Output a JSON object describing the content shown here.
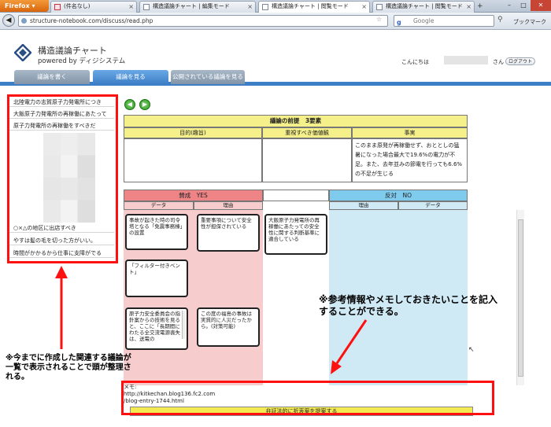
{
  "browser": {
    "app_button": "Firefox ▾",
    "tabs": [
      {
        "label": "(件名なし)"
      },
      {
        "label": "構造議論チャート | 編集モード"
      },
      {
        "label": "構造議論チャート | 閲覧モード"
      },
      {
        "label": "構造議論チャート | 閲覧モード"
      }
    ],
    "url": "structure-notebook.com/discuss/read.php",
    "search_placeholder": "Google",
    "bookmarks_label": "ブックマーク"
  },
  "header": {
    "title": "構造議論チャート",
    "subtitle": "powered by ディジシステム",
    "greeting": "こんにちは",
    "san": "さん",
    "logout": "ログアウト"
  },
  "nav_tabs": [
    {
      "label": "議論を書く"
    },
    {
      "label": "議論を見る"
    },
    {
      "label": "公開されている議論を見る"
    }
  ],
  "sidebar": {
    "items": [
      "北陸電力の志賀原子力発電所につき",
      "大飯原子力発電所の再稼働にあたって",
      "原子力発電所の再稼働をすべきだ",
      "○×△の地区に出店すべき",
      "やすは髪の毛を切った方がいい。",
      "時間がかかるから仕事に支障がでる"
    ]
  },
  "premise": {
    "title": "議論の前提　3要素",
    "columns": [
      "目的(趣旨)",
      "重視すべき価値観",
      "事実"
    ],
    "fact_text": "このまま原発が再稼働せず、おととしの猛暑になった場合最大で19.6%の電力が不足。また、去年並みの節電を行っても6.6%の不足が生じる"
  },
  "yes": {
    "title": "賛成　YES",
    "sub": [
      "データ",
      "理由"
    ]
  },
  "no": {
    "title": "反対　NO",
    "sub": [
      "理由",
      "データ"
    ]
  },
  "cards": {
    "data1": "事故が起きた時の司令塔となる「免震事務棟」の設置",
    "data2": "「フィルター付きベント」",
    "data3": "原子力安全委員会の指針案からの技術を見ると、ここに「長期間にわたる全交流電源喪失は、送電の",
    "reason1": "重要事項について安全性が担保されている",
    "reason2": "この度の福島の事故は実質的に人災だったから。(対策可能)",
    "center": "大飯原子力発電所の再稼働にあたっての安全性に関する判断基準に適合している"
  },
  "memo": {
    "label": "メモ:",
    "line1": "http://kitkechan.blog136.fc2.com",
    "line2": "/blog-entry-1744.html"
  },
  "action_button": "弁証法的に折衷案を提案する",
  "annotations": {
    "left": "※今までに作成した関連する議論が一覧で表示されることで頭が整理される。",
    "right": "※参考情報やメモしておきたいことを記入することができる。"
  },
  "colors": {
    "annotation_red": "#ff1010",
    "yes_pink": "#ee8486",
    "yes_column": "#f6cccd",
    "no_blue": "#7fcbee",
    "no_column": "#cfeaf5",
    "premise_yellow": "#f5f08a",
    "nav_blue": "#3d7fc6"
  },
  "icons": [
    "firefox-logo-icon",
    "gmail-icon",
    "page-icon",
    "back-icon",
    "star-icon",
    "google-icon",
    "search-icon",
    "logo-icon",
    "prev-arrow-icon",
    "next-arrow-icon",
    "cursor-icon"
  ]
}
